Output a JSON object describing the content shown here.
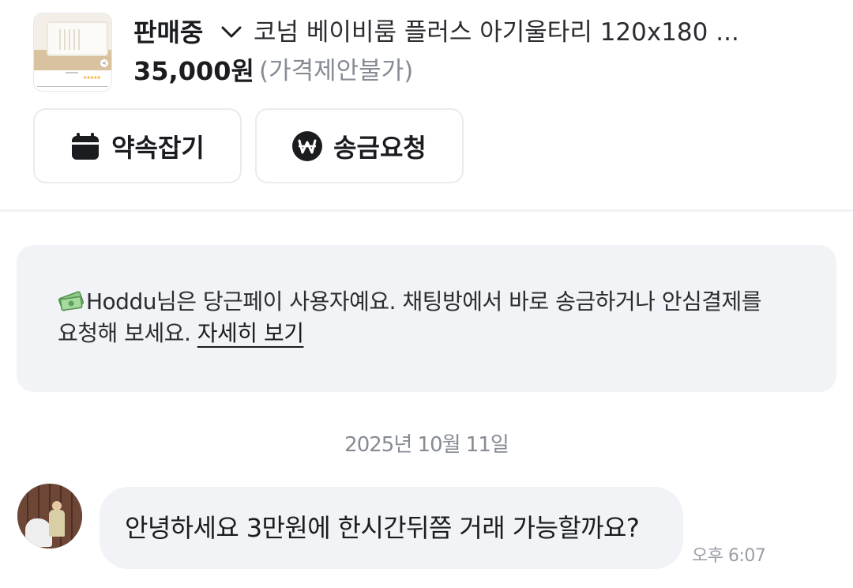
{
  "product": {
    "status": "판매중",
    "title": "코넘 베이비룸 플러스 아기울타리 120x180 ...",
    "price": "35,000원",
    "price_note": "(가격제안불가)"
  },
  "actions": {
    "schedule_label": "약속잡기",
    "remit_label": "송금요청"
  },
  "banner": {
    "text": "Hoddu님은 당근페이 사용자예요. 채팅방에서 바로 송금하거나 안심결제를 요청해 보세요.",
    "link_label": "자세히 보기"
  },
  "chat": {
    "date": "2025년 10월 11일",
    "messages": [
      {
        "text": "안녕하세요 3만원에 한시간뒤쯤 거래 가능할까요?",
        "time": "오후 6:07"
      }
    ]
  },
  "colors": {
    "text_primary": "#1a1c20",
    "text_secondary": "#868b94",
    "bubble_bg": "#f2f3f6",
    "button_border": "#e9ebee"
  },
  "icons": {
    "status_toggle": "chevron-down-icon",
    "schedule": "calendar-icon",
    "remit": "won-coin-icon",
    "banner": "money-icon"
  }
}
